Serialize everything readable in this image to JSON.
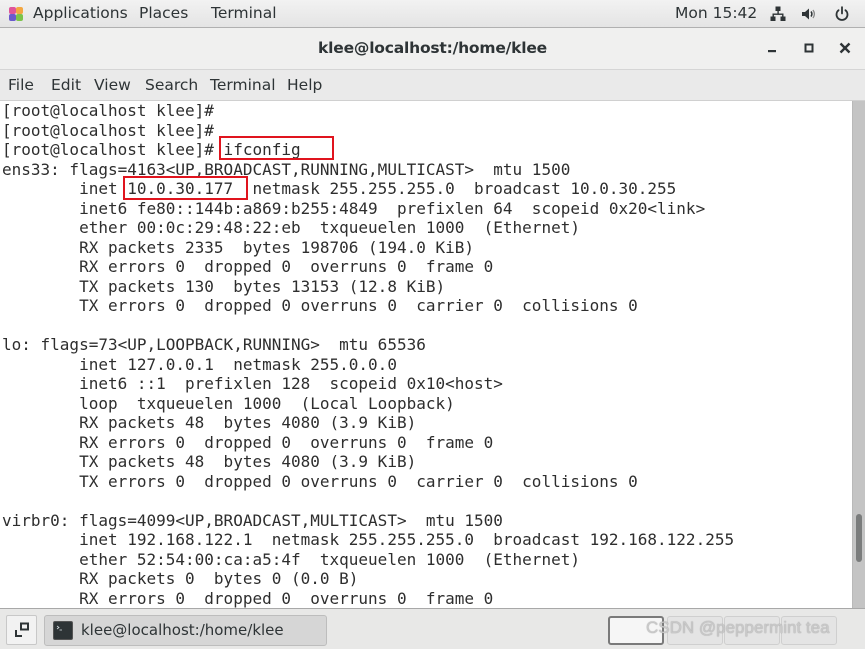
{
  "topbar": {
    "applications": "Applications",
    "places": "Places",
    "terminal": "Terminal",
    "clock": "Mon 15:42",
    "tray_icons": [
      "network-icon",
      "volume-icon",
      "power-icon"
    ]
  },
  "window": {
    "title": "klee@localhost:/home/klee",
    "controls": [
      "minimize",
      "maximize",
      "close"
    ]
  },
  "menubar": {
    "items": [
      "File",
      "Edit",
      "View",
      "Search",
      "Terminal",
      "Help"
    ]
  },
  "terminal": {
    "lines": [
      "[root@localhost klee]#",
      "[root@localhost klee]#",
      "[root@localhost klee]# ifconfig",
      "ens33: flags=4163<UP,BROADCAST,RUNNING,MULTICAST>  mtu 1500",
      "        inet 10.0.30.177  netmask 255.255.255.0  broadcast 10.0.30.255",
      "        inet6 fe80::144b:a869:b255:4849  prefixlen 64  scopeid 0x20<link>",
      "        ether 00:0c:29:48:22:eb  txqueuelen 1000  (Ethernet)",
      "        RX packets 2335  bytes 198706 (194.0 KiB)",
      "        RX errors 0  dropped 0  overruns 0  frame 0",
      "        TX packets 130  bytes 13153 (12.8 KiB)",
      "        TX errors 0  dropped 0 overruns 0  carrier 0  collisions 0",
      "",
      "lo: flags=73<UP,LOOPBACK,RUNNING>  mtu 65536",
      "        inet 127.0.0.1  netmask 255.0.0.0",
      "        inet6 ::1  prefixlen 128  scopeid 0x10<host>",
      "        loop  txqueuelen 1000  (Local Loopback)",
      "        RX packets 48  bytes 4080 (3.9 KiB)",
      "        RX errors 0  dropped 0  overruns 0  frame 0",
      "        TX packets 48  bytes 4080 (3.9 KiB)",
      "        TX errors 0  dropped 0 overruns 0  carrier 0  collisions 0",
      "",
      "virbr0: flags=4099<UP,BROADCAST,MULTICAST>  mtu 1500",
      "        inet 192.168.122.1  netmask 255.255.255.0  broadcast 192.168.122.255",
      "        ether 52:54:00:ca:a5:4f  txqueuelen 1000  (Ethernet)",
      "        RX packets 0  bytes 0 (0.0 B)",
      "        RX errors 0  dropped 0  overruns 0  frame 0"
    ],
    "highlights": [
      {
        "label": "ifconfig",
        "color": "#e0141e"
      },
      {
        "label": "10.0.30.177",
        "color": "#e0141e"
      }
    ],
    "scroll_position_fraction": 0.92
  },
  "taskbar": {
    "window_button": "klee@localhost:/home/klee",
    "workspaces": 4,
    "active_workspace": 1
  },
  "watermark": "CSDN @peppermint tea"
}
